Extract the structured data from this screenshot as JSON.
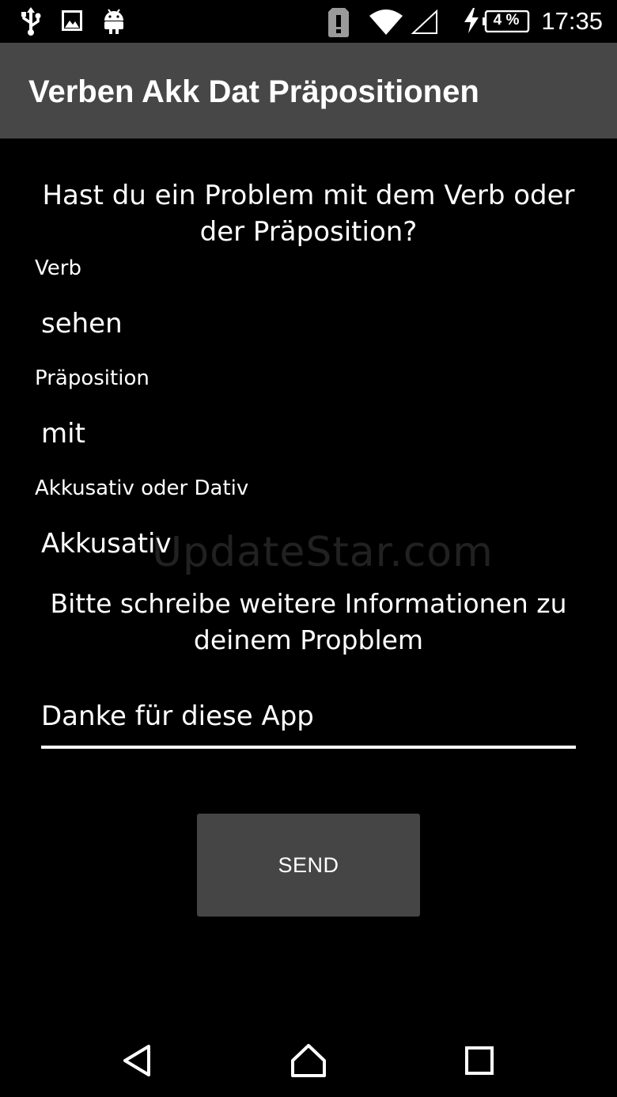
{
  "status_bar": {
    "time": "17:35",
    "battery_percent": "4 %",
    "icons": [
      "usb-icon",
      "image-icon",
      "android-icon",
      "alert-icon",
      "wifi-icon",
      "cell-signal-icon",
      "charging-icon",
      "battery-icon"
    ]
  },
  "toolbar": {
    "title": "Verben Akk Dat Präpositionen"
  },
  "form": {
    "question": "Hast du ein Problem mit dem Verb oder der Präposition?",
    "verb_label": "Verb",
    "verb_value": "sehen",
    "preposition_label": "Präposition",
    "preposition_value": "mit",
    "case_label": "Akkusativ oder Dativ",
    "case_value": "Akkusativ",
    "info_prompt": "Bitte schreibe weitere Informationen zu deinem Propblem",
    "comment_value": "Danke für diese App",
    "send_label": "SEND"
  },
  "watermark": "UpdateStar.com",
  "navigation": {
    "icons": [
      "back-icon",
      "home-icon",
      "recents-icon"
    ]
  },
  "colors": {
    "background": "#000000",
    "toolbar": "#474747",
    "button": "#454545",
    "text": "#ffffff"
  }
}
